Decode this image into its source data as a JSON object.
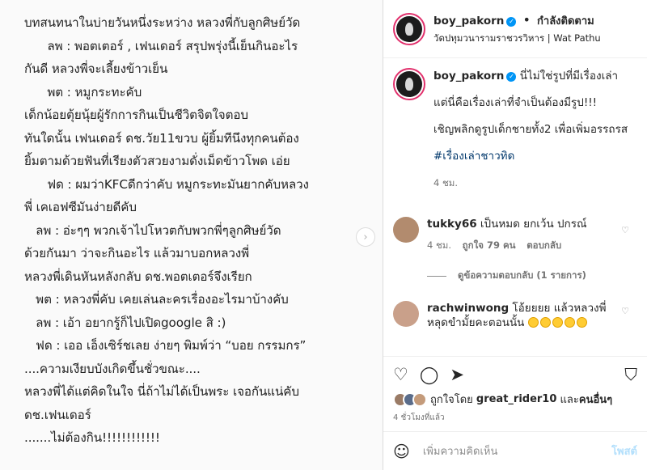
{
  "story": {
    "lines": [
      "บทสนทนาในบ่ายวันหนึ่งระหว่าง หลวงพี่กับลูกศิษย์วัด",
      "      ลพ : พอตเตอร์ , เฟนเดอร์ สรุปพรุ่งนี้เย็นกินอะไร",
      "กันดี หลวงพี่จะเลี้ยงข้าวเย็น",
      "      พต : หมูกระทะคับ",
      "เด็กน้อยตุ้ยนุ้ยผู้รักการกินเป็นชีวิตจิตใจตอบ",
      "ทันใดนั้น เฟนเดอร์ ดช.วัย11ขวบ ผู้ยิ้มทีนึงทุกคนต้อง",
      "ยิ้มตามด้วยฟันที่เรียงตัวสวยงามดั่งเม็ดข้าวโพด เอ่ย",
      "      ฟด : ผมว่าKFCดีกว่าคับ หมูกระทะมันยากคับหลวง",
      "พี่ เคเอฟซีมันง่ายดีคับ",
      "   ลพ : อ่ะๆๆ พวกเจ้าไปโหวตกับพวกพี่ๆลูกศิษย์วัด",
      "ด้วยกันมา ว่าจะกินอะไร แล้วมาบอกหลวงพี่",
      "หลวงพี่เดินหันหลังกลับ ดช.พอตเตอร์จึงเรียก",
      "   พต : หลวงพี่คับ เคยเล่นละครเรื่องอะไรมาบ้างคับ",
      "   ลพ : เอ้า อยากรู้ก็ไปเปิดgoogle สิ :)",
      "   ฟด : เออ เอ็งเซิร์ชเลย ง่ายๆ พิมพ์ว่า “บอย กรรมกร”",
      "....ความเงียบบังเกิดขึ้นชั่วขณะ....",
      "หลวงพี่ได้แต่คิดในใจ นี่ถ้าไม่ได้เป็นพระ เจอกันแน่คับ",
      "ดช.เฟนเดอร์",
      ".......ไม่ต้องกิน!!!!!!!!!!!!"
    ]
  },
  "header": {
    "username": "boy_pakorn",
    "verified_mark": "✓",
    "separator": "•",
    "follow_status": "กำลังติดตาม",
    "location": "วัดปทุมวนารามราชวรวิหาร | Wat Pathu"
  },
  "caption": {
    "username": "boy_pakorn",
    "text1": "นี่ไม่ใช่รูปที่มีเรื่องเล่า",
    "text2": "แต่นี่คือเรื่องเล่าที่จำเป็นต้องมีรูป!!!",
    "text3": "เชิญพลิกดูรูปเด็กชายทั้ง2 เพื่อเพิ่มอรรถรส",
    "hashtag": "#เรื่องเล่าชาวทิด",
    "time": "4 ชม."
  },
  "comments": [
    {
      "username": "tukky66",
      "text": "เป็นหมด ยกเว้น ปกรณ์",
      "time": "4 ชม.",
      "likes": "ถูกใจ 79 คน",
      "reply": "ตอบกลับ"
    },
    {
      "username": "rachwinwong",
      "text": "โอ้ยยยย แล้วหลวงพี่หลุดขำมั้ยคะตอนนั้น",
      "emoji_count": "5"
    }
  ],
  "replies_toggle": "ดูข้อความตอบกลับ (1 รายการ)",
  "likes": {
    "prefix": "ถูกใจโดย",
    "user": "great_rider10",
    "and": "และ",
    "others": "คนอื่นๆ",
    "ago": "4 ชั่วโมงที่แล้ว"
  },
  "add_comment": {
    "placeholder": "เพิ่มความคิดเห็น",
    "post": "โพสต์"
  },
  "icons": {
    "heart": "♡",
    "comment": "◯",
    "share": "➤",
    "save": "⛉",
    "smile": "☺",
    "next": "›"
  }
}
